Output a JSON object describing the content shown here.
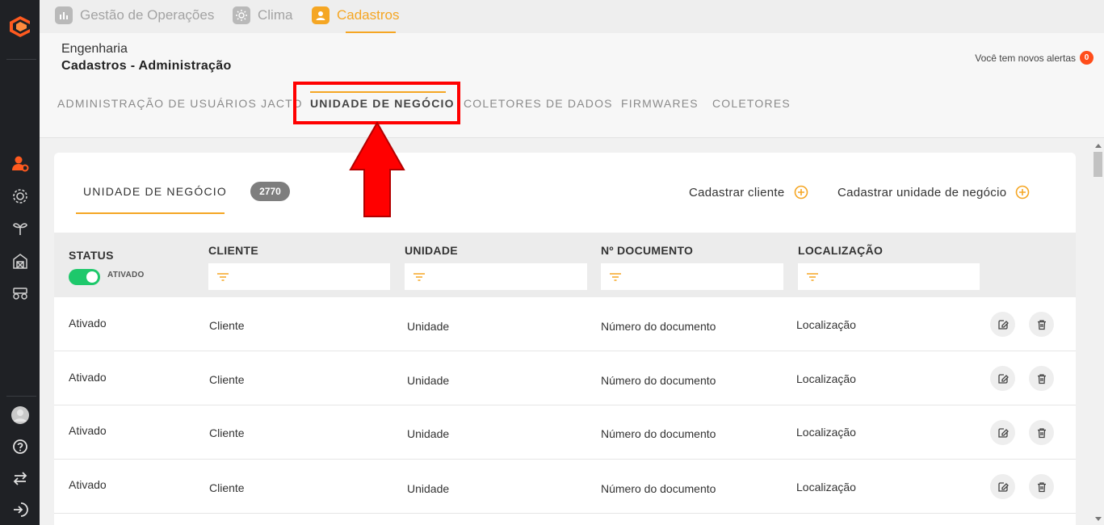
{
  "app_tabs": [
    {
      "label": "Gestão de Operações",
      "icon": "operations-icon"
    },
    {
      "label": "Clima",
      "icon": "sun-icon"
    },
    {
      "label": "Cadastros",
      "icon": "user-icon",
      "active": true
    }
  ],
  "header": {
    "breadcrumb_1": "Engenharia",
    "breadcrumb_2": "Cadastros - Administração",
    "alerts_text": "Você tem novos alertas",
    "alerts_count": "0"
  },
  "subtabs": [
    {
      "label": "ADMINISTRAÇÃO DE USUÁRIOS JACTO"
    },
    {
      "label": "UNIDADE DE NEGÓCIO",
      "active": true
    },
    {
      "label": "COLETORES DE DADOS"
    },
    {
      "label": "FIRMWARES"
    },
    {
      "label": "COLETORES"
    }
  ],
  "card": {
    "tab_label": "UNIDADE DE NEGÓCIO",
    "count": "2770",
    "add_client": "Cadastrar cliente",
    "add_unit": "Cadastrar unidade de negócio"
  },
  "table": {
    "headers": {
      "status": "STATUS",
      "client": "CLIENTE",
      "unit": "UNIDADE",
      "document": "Nº DOCUMENTO",
      "location": "LOCALIZAÇÃO"
    },
    "status_toggle_label": "ATIVADO",
    "rows": [
      {
        "status": "Ativado",
        "client": "Cliente",
        "unit": "Unidade",
        "document": "Número do documento",
        "location": "Localização"
      },
      {
        "status": "Ativado",
        "client": "Cliente",
        "unit": "Unidade",
        "document": "Número do documento",
        "location": "Localização"
      },
      {
        "status": "Ativado",
        "client": "Cliente",
        "unit": "Unidade",
        "document": "Número do documento",
        "location": "Localização"
      },
      {
        "status": "Ativado",
        "client": "Cliente",
        "unit": "Unidade",
        "document": "Número do documento",
        "location": "Localização"
      }
    ]
  },
  "colors": {
    "accent": "#f5a623",
    "sidebar_bg": "#1f2125",
    "active_icon": "#ff5a1f",
    "toggle_on": "#1ec86b",
    "annotation_red": "#ff0000"
  }
}
